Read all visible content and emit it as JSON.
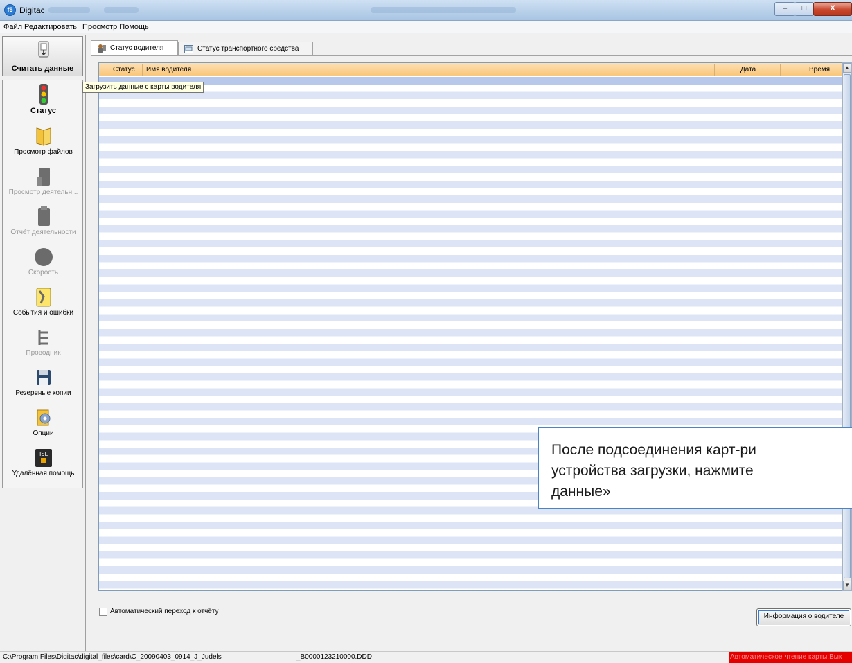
{
  "window": {
    "title": "Digitac",
    "app_icon": "f5"
  },
  "menu": [
    "Файл",
    "Редактировать",
    "Просмотр",
    "Помощь"
  ],
  "sidebar": {
    "read_button": "Считать данные",
    "items": [
      {
        "label": "Статус",
        "icon": "traffic-light-icon",
        "state": "active"
      },
      {
        "label": "Просмотр файлов",
        "icon": "folder-icon",
        "state": "enabled"
      },
      {
        "label": "Просмотр деятельн...",
        "icon": "card-icon",
        "state": "disabled"
      },
      {
        "label": "Отчёт деятельности",
        "icon": "report-icon",
        "state": "disabled"
      },
      {
        "label": "Скорость",
        "icon": "speed-icon",
        "state": "disabled"
      },
      {
        "label": "События и ошибки",
        "icon": "wrench-icon",
        "state": "enabled"
      },
      {
        "label": "Проводник",
        "icon": "tree-icon",
        "state": "disabled"
      },
      {
        "label": "Резервные копии",
        "icon": "floppy-icon",
        "state": "enabled"
      },
      {
        "label": "Опции",
        "icon": "options-icon",
        "state": "enabled"
      },
      {
        "label": "Удалённая помощь",
        "icon": "isl-icon",
        "state": "enabled"
      }
    ]
  },
  "tooltip": "Загрузить данные с карты водителя",
  "tabs": [
    {
      "label": "Статус водителя",
      "active": true
    },
    {
      "label": "Статус транспортного средства",
      "active": false
    }
  ],
  "table": {
    "columns": [
      "Статус",
      "Имя водителя",
      "Дата",
      "Время"
    ],
    "rows": []
  },
  "auto_report_checkbox": {
    "label": "Автоматический переход к отчёту",
    "checked": false
  },
  "driver_info_button": "Информация о водителе",
  "statusbar": {
    "path": "C:\\Program Files\\Digitac\\digital_files\\card\\C_20090403_0914_J_Judels",
    "file": "_B0000123210000.DDD",
    "auto_read": "Автоматическое чтение карты:Вык"
  },
  "callout": {
    "line1": "После подсоединения карт-ри",
    "line2": "устройства загрузки, нажмите",
    "line3": "данные»"
  },
  "colors": {
    "header": "#f9c77a",
    "row_alt": "#dde4f6",
    "selected_row": "#b8c8ea",
    "status_red": "#e50000",
    "callout_border": "#4a84c4"
  }
}
